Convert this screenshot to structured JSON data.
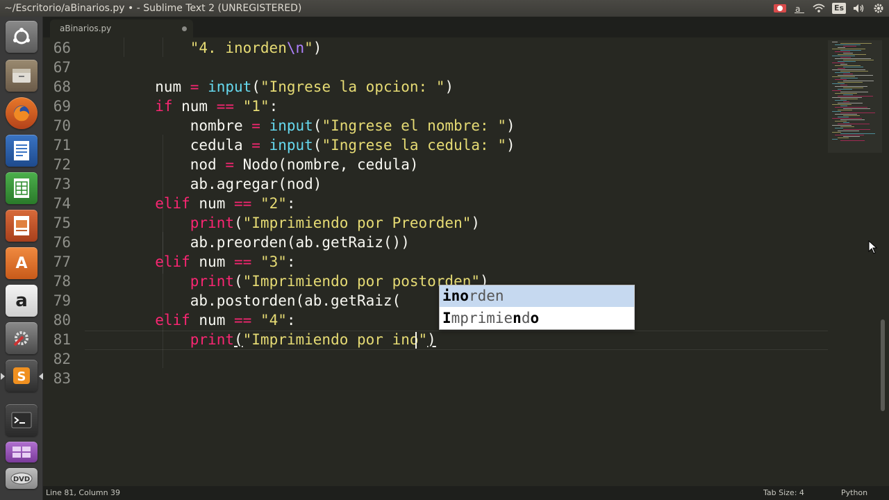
{
  "window": {
    "title": "~/Escritorio/aBinarios.py • - Sublime Text 2 (UNREGISTERED)"
  },
  "tray": {
    "keyboard_layout": "Es",
    "icons": [
      "record-icon",
      "text-input-icon",
      "wifi-icon",
      "keyboard-layout-indicator",
      "volume-icon",
      "settings-gear-icon"
    ]
  },
  "launcher": {
    "icons": [
      "ubuntu-dash-icon",
      "file-manager-icon",
      "firefox-icon",
      "libreoffice-writer-icon",
      "libreoffice-calc-icon",
      "libreoffice-impress-icon",
      "software-center-icon",
      "amazon-icon",
      "system-settings-icon",
      "sublime-text-icon",
      "terminal-icon",
      "workspace-switcher-icon",
      "dvd-icon"
    ]
  },
  "tab": {
    "label": "aBinarios.py"
  },
  "editor": {
    "line_numbers": [
      "66",
      "67",
      "68",
      "69",
      "70",
      "71",
      "72",
      "73",
      "74",
      "75",
      "76",
      "77",
      "78",
      "79",
      "80",
      "81",
      "82",
      "83"
    ],
    "lines": [
      [
        {
          "t": "    ",
          "c": ""
        },
        {
          "t": "\"4. inorden",
          "c": "str"
        },
        {
          "t": "\\n",
          "c": "esc"
        },
        {
          "t": "\"",
          "c": "str"
        },
        {
          "t": ")",
          "c": ""
        }
      ],
      [],
      [
        {
          "t": "num ",
          "c": ""
        },
        {
          "t": "=",
          "c": "op"
        },
        {
          "t": " ",
          "c": ""
        },
        {
          "t": "input",
          "c": "fn"
        },
        {
          "t": "(",
          "c": ""
        },
        {
          "t": "\"Ingrese la opcion: \"",
          "c": "str"
        },
        {
          "t": ")",
          "c": ""
        }
      ],
      [
        {
          "t": "if",
          "c": "kw"
        },
        {
          "t": " num ",
          "c": ""
        },
        {
          "t": "==",
          "c": "op"
        },
        {
          "t": " ",
          "c": ""
        },
        {
          "t": "\"1\"",
          "c": "str"
        },
        {
          "t": ":",
          "c": ""
        }
      ],
      [
        {
          "t": "    nombre ",
          "c": ""
        },
        {
          "t": "=",
          "c": "op"
        },
        {
          "t": " ",
          "c": ""
        },
        {
          "t": "input",
          "c": "fn"
        },
        {
          "t": "(",
          "c": ""
        },
        {
          "t": "\"Ingrese el nombre: \"",
          "c": "str"
        },
        {
          "t": ")",
          "c": ""
        }
      ],
      [
        {
          "t": "    cedula ",
          "c": ""
        },
        {
          "t": "=",
          "c": "op"
        },
        {
          "t": " ",
          "c": ""
        },
        {
          "t": "input",
          "c": "fn"
        },
        {
          "t": "(",
          "c": ""
        },
        {
          "t": "\"Ingrese la cedula: \"",
          "c": "str"
        },
        {
          "t": ")",
          "c": ""
        }
      ],
      [
        {
          "t": "    nod ",
          "c": ""
        },
        {
          "t": "=",
          "c": "op"
        },
        {
          "t": " Nodo(nombre, cedula)",
          "c": ""
        }
      ],
      [
        {
          "t": "    ab.agregar(nod)",
          "c": ""
        }
      ],
      [
        {
          "t": "elif",
          "c": "kw"
        },
        {
          "t": " num ",
          "c": ""
        },
        {
          "t": "==",
          "c": "op"
        },
        {
          "t": " ",
          "c": ""
        },
        {
          "t": "\"2\"",
          "c": "str"
        },
        {
          "t": ":",
          "c": ""
        }
      ],
      [
        {
          "t": "    ",
          "c": ""
        },
        {
          "t": "print",
          "c": "kw"
        },
        {
          "t": "(",
          "c": ""
        },
        {
          "t": "\"Imprimiendo por Preorden\"",
          "c": "str"
        },
        {
          "t": ")",
          "c": ""
        }
      ],
      [
        {
          "t": "    ab.preorden(ab.getRaiz())",
          "c": ""
        }
      ],
      [
        {
          "t": "elif",
          "c": "kw"
        },
        {
          "t": " num ",
          "c": ""
        },
        {
          "t": "==",
          "c": "op"
        },
        {
          "t": " ",
          "c": ""
        },
        {
          "t": "\"3\"",
          "c": "str"
        },
        {
          "t": ":",
          "c": ""
        }
      ],
      [
        {
          "t": "    ",
          "c": ""
        },
        {
          "t": "print",
          "c": "kw"
        },
        {
          "t": "(",
          "c": ""
        },
        {
          "t": "\"Imprimiendo por postorden\"",
          "c": "str"
        },
        {
          "t": ")",
          "c": ""
        }
      ],
      [
        {
          "t": "    ab.postorden(ab.getRaiz(",
          "c": ""
        }
      ],
      [
        {
          "t": "elif",
          "c": "kw"
        },
        {
          "t": " num ",
          "c": ""
        },
        {
          "t": "==",
          "c": "op"
        },
        {
          "t": " ",
          "c": ""
        },
        {
          "t": "\"4\"",
          "c": "str"
        },
        {
          "t": ":",
          "c": ""
        }
      ],
      [
        {
          "t": "    ",
          "c": ""
        },
        {
          "t": "print",
          "c": "kw"
        },
        {
          "t": "(",
          "c": ""
        },
        {
          "t": "\"Imprimiendo por ino\"",
          "c": "str"
        },
        {
          "t": ")",
          "c": ""
        }
      ],
      [],
      []
    ]
  },
  "autocomplete": {
    "items": [
      {
        "label": "inorden",
        "selected": true
      },
      {
        "label": "Imprimiendo",
        "selected": false
      }
    ]
  },
  "status": {
    "position": "Line 81, Column 39",
    "tab_size": "Tab Size: 4",
    "syntax": "Python"
  },
  "colors": {
    "background": "#272822",
    "keyword": "#f92672",
    "function": "#66d9ef",
    "string": "#e6db74",
    "escape": "#ae81ff"
  }
}
